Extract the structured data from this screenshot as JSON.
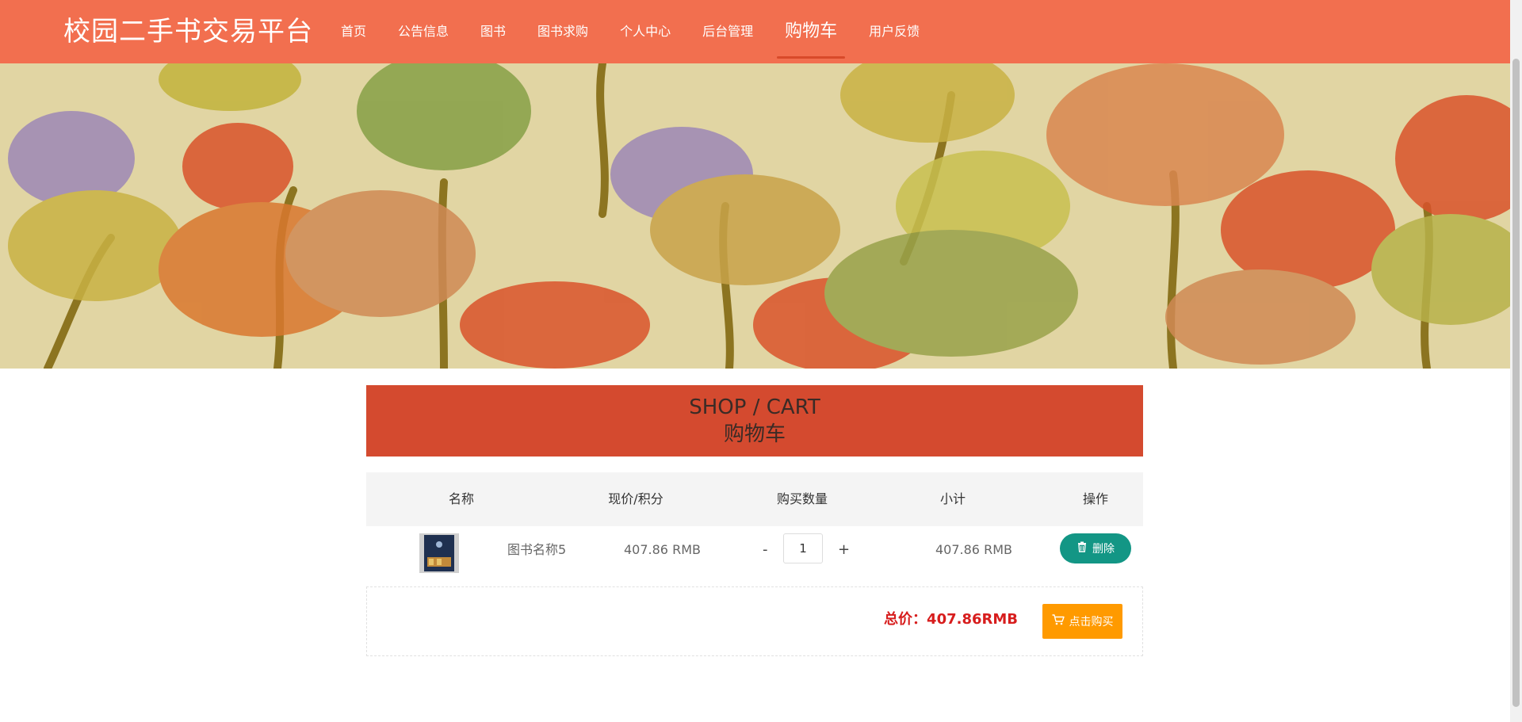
{
  "site": {
    "brand": "校园二手书交易平台"
  },
  "nav": {
    "items": [
      {
        "label": "首页"
      },
      {
        "label": "公告信息"
      },
      {
        "label": "图书"
      },
      {
        "label": "图书求购"
      },
      {
        "label": "个人中心"
      },
      {
        "label": "后台管理"
      },
      {
        "label": "购物车",
        "active": true
      },
      {
        "label": "用户反馈"
      }
    ]
  },
  "banner": {
    "slides": 3,
    "active_slide": 1
  },
  "section": {
    "title_en": "SHOP / CART",
    "title_cn": "购物车"
  },
  "table": {
    "headers": [
      "名称",
      "现价/积分",
      "购买数量",
      "小计",
      "操作"
    ],
    "rows": [
      {
        "name": "图书名称5",
        "price": "407.86 RMB",
        "qty_minus": "-",
        "quantity": "1",
        "qty_plus": "+",
        "subtotal": "407.86 RMB",
        "action_label": "删除",
        "action_icon": "trash-icon"
      }
    ]
  },
  "summary": {
    "total_label": "总价：407.86RMB",
    "buy_label": "点击购买",
    "buy_icon": "cart-icon"
  },
  "colors": {
    "header": "#f26f4f",
    "section_bar": "#d44a2f",
    "delete_button": "#139685",
    "buy_button": "#ff9a00",
    "total_text": "#d71d1d"
  }
}
